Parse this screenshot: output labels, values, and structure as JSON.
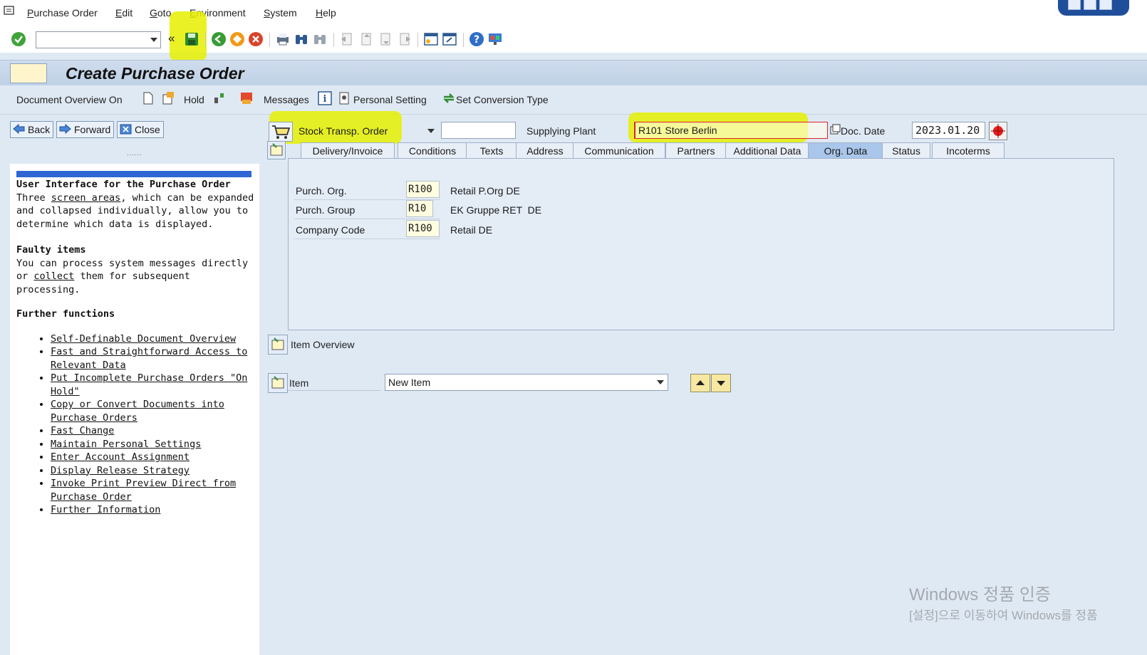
{
  "menu": {
    "items": [
      "Purchase Order",
      "Edit",
      "Goto",
      "Environment",
      "System",
      "Help"
    ]
  },
  "toolbar": {
    "command_field_value": "",
    "back_double_arrow": "«",
    "icons": [
      "enter-icon",
      "save-icon",
      "back-icon",
      "exit-icon",
      "cancel-icon",
      "print-icon",
      "find-icon",
      "find-next-icon",
      "first-page-icon",
      "previous-page-icon",
      "next-page-icon",
      "last-page-icon",
      "create-session-icon",
      "shortcut-icon",
      "help-icon",
      "customize-layout-icon"
    ]
  },
  "title": "Create Purchase Order",
  "app_toolbar": {
    "document_overview": "Document Overview On",
    "hold": "Hold",
    "messages": "Messages",
    "personal_setting": "Personal Setting",
    "set_conversion_type": "Set Conversion Type"
  },
  "left_panel": {
    "back": "Back",
    "forward": "Forward",
    "close": "Close",
    "splitter_dots": "......",
    "help": {
      "heading1": "User Interface for the Purchase Order",
      "p1_a": "Three",
      "p1_link": "screen areas",
      "p1_b": ", which can be expanded and collapsed individually, allow you to determine which data is displayed.",
      "heading2": "Faulty items",
      "p2_a": "You can process system messages directly or",
      "p2_link": "collect",
      "p2_b": "them for subsequent processing.",
      "heading3": "Further functions",
      "links": [
        "Self-Definable Document Overview",
        "Fast and Straightforward Access to Relevant Data",
        "Put Incomplete Purchase Orders \"On Hold\"",
        "Copy or Convert Documents into Purchase Orders",
        "Fast Change",
        "Maintain Personal Settings",
        "Enter Account Assignment",
        "Display Release Strategy",
        "Invoke Print Preview Direct from Purchase Order",
        "Further Information"
      ]
    }
  },
  "header": {
    "order_type": "Stock Transp. Order",
    "order_number": "",
    "supplying_plant_label": "Supplying Plant",
    "supplying_plant_value": "R101 Store Berlin",
    "doc_date_label": "Doc. Date",
    "doc_date_value": "2023.01.20"
  },
  "tabs": [
    "Delivery/Invoice",
    "Conditions",
    "Texts",
    "Address",
    "Communication",
    "Partners",
    "Additional Data",
    "Org. Data",
    "Status",
    "Incoterms"
  ],
  "active_tab": "Org. Data",
  "org_data": [
    {
      "label": "Purch. Org.",
      "value": "R100",
      "desc": "Retail P.Org DE"
    },
    {
      "label": "Purch. Group",
      "value": "R10",
      "desc": "EK Gruppe RET  DE"
    },
    {
      "label": "Company Code",
      "value": "R100",
      "desc": "Retail DE"
    }
  ],
  "item_overview_label": "Item Overview",
  "item": {
    "label": "Item",
    "value": "New Item"
  },
  "watermark": {
    "line1": "Windows 정품 인증",
    "line2": "[설정]으로 이동하여 Windows를 정품"
  },
  "colors": {
    "highlight": "#e6f000",
    "background": "#dfe9f4",
    "active_tab": "#aac6ea"
  }
}
